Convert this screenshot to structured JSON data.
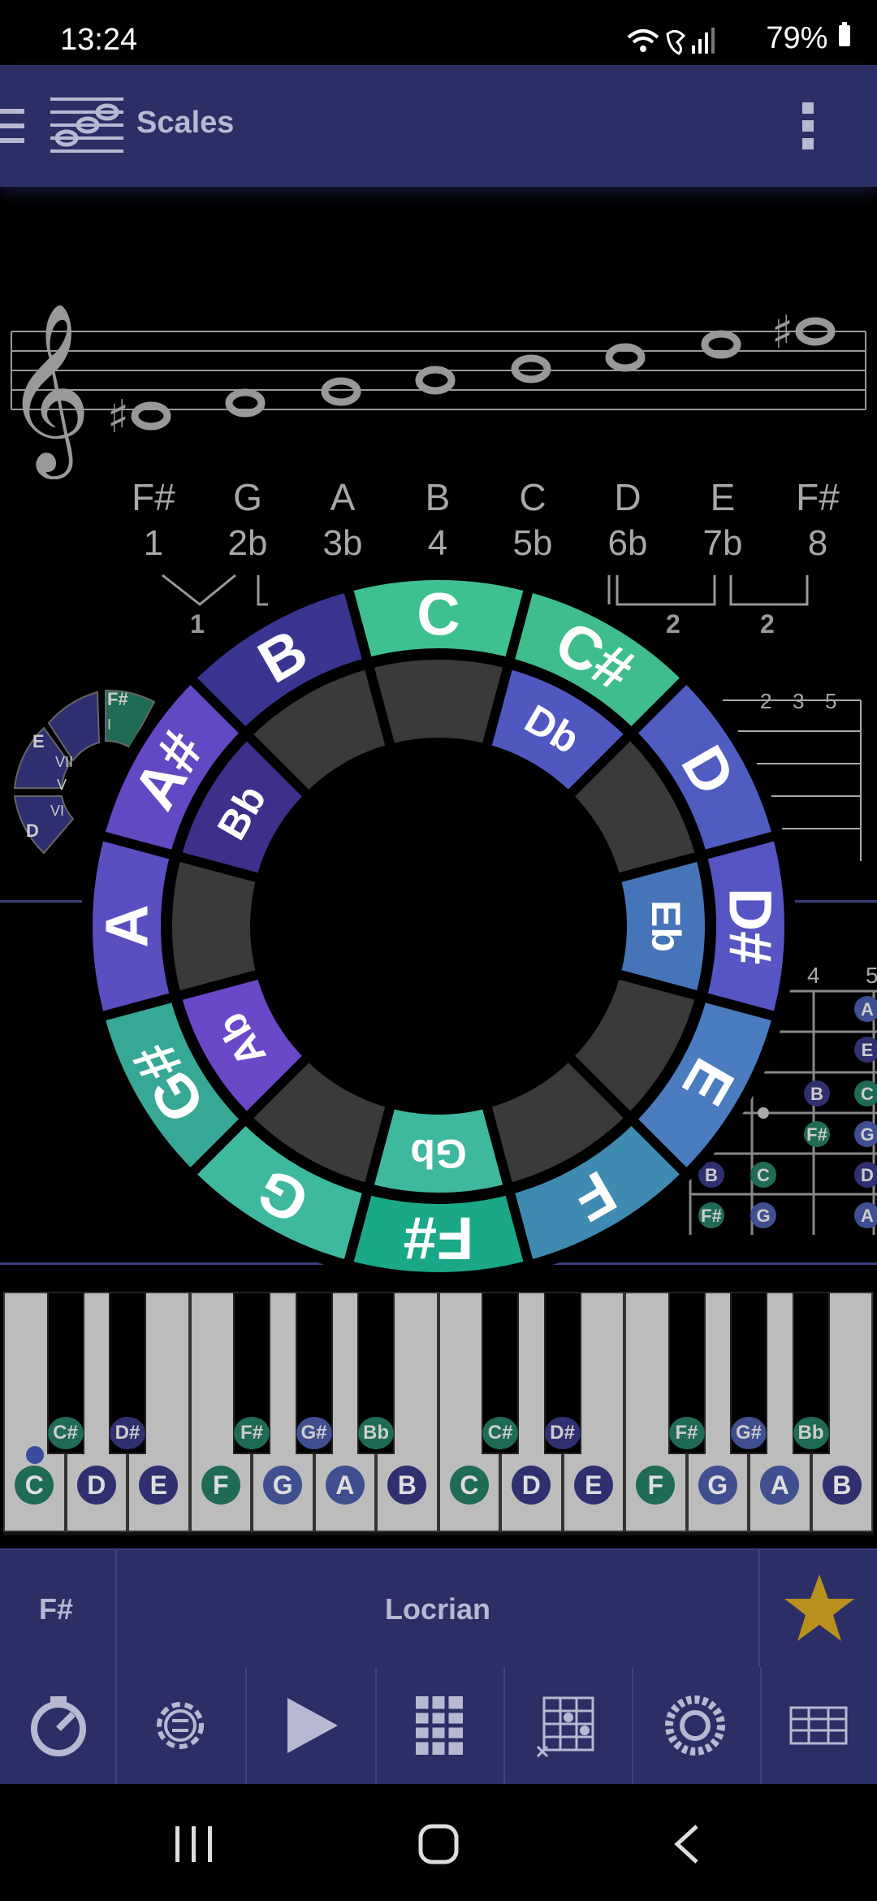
{
  "status": {
    "time": "13:24",
    "battery": "79%",
    "icons": [
      "wifi-icon",
      "wifi-call-icon",
      "signal-icon",
      "battery-icon"
    ]
  },
  "appbar": {
    "title": "Scales",
    "icons": [
      "menu-icon",
      "scales-logo-icon",
      "more-vert-icon"
    ]
  },
  "staff": {
    "notes": [
      "F#",
      "G",
      "A",
      "B",
      "C",
      "D",
      "E",
      "F#"
    ],
    "intervals": [
      "1",
      "2b",
      "3b",
      "4",
      "5b",
      "6b",
      "7b",
      "8"
    ],
    "steps": [
      "1",
      "2",
      "2"
    ]
  },
  "circle": {
    "outer": [
      "C",
      "C#",
      "D",
      "D#",
      "E",
      "F",
      "F#",
      "G",
      "G#",
      "A",
      "A#",
      "B"
    ],
    "inner": [
      "",
      "Db",
      "",
      "Eb",
      "",
      "",
      "Gb",
      "",
      "Ab",
      "",
      "Bb",
      ""
    ]
  },
  "mini_wheel": {
    "labels": [
      "F#",
      "I",
      "E",
      "VII",
      "D",
      "VI",
      "V"
    ]
  },
  "fret_numbers": [
    "2",
    "3",
    "5",
    "4",
    "5"
  ],
  "fretboard_notes": [
    "A",
    "E",
    "B",
    "C",
    "F#",
    "G",
    "B",
    "C",
    "D",
    "F#",
    "G",
    "A"
  ],
  "piano": {
    "white_notes": [
      "C",
      "D",
      "E",
      "F",
      "G",
      "A",
      "B",
      "C",
      "D",
      "E",
      "F",
      "G",
      "A",
      "B"
    ],
    "black_notes": [
      "C#",
      "D#",
      "F#",
      "G#",
      "Bb",
      "C#",
      "D#",
      "F#",
      "G#",
      "Bb"
    ]
  },
  "selector": {
    "root": "F#",
    "scale": "Locrian",
    "favorite_icon": "star-icon"
  },
  "toolbar": {
    "icons": [
      "metronome-icon",
      "settings-icon",
      "play-icon",
      "grid-icon",
      "fretboard-icon",
      "circle-icon",
      "sheet-icon"
    ]
  },
  "navbar": {
    "icons": [
      "recents-icon",
      "home-icon",
      "back-icon"
    ]
  },
  "colors": {
    "appbar": "#2b2f66",
    "teal": "#3fb8a0",
    "purple": "#5a4fc0",
    "blue": "#4a7cbf"
  }
}
